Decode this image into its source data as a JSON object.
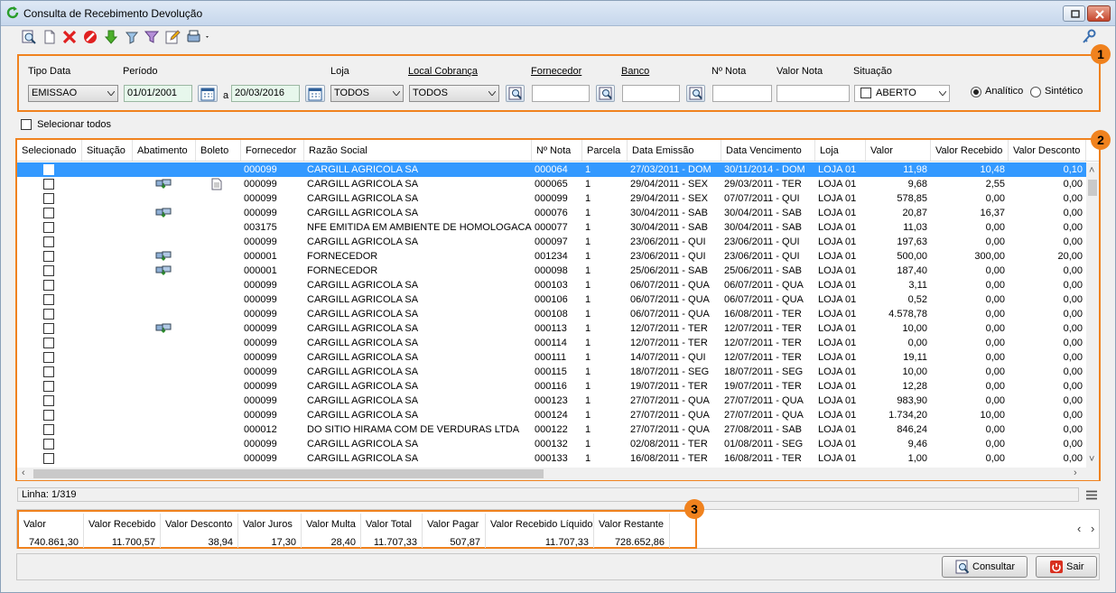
{
  "window": {
    "title": "Consulta de Recebimento Devolução"
  },
  "toolbar": {
    "icons": [
      "search-doc-icon",
      "new-doc-icon",
      "delete-icon",
      "cancel-icon",
      "download-arrow-icon",
      "filter-settings-icon",
      "funnel-icon",
      "edit-icon",
      "print-icon"
    ]
  },
  "filters": {
    "tipo_data_label": "Tipo Data",
    "tipo_data_value": "EMISSAO",
    "periodo_label": "Período",
    "periodo_start": "01/01/2001",
    "periodo_sep": "a",
    "periodo_end": "20/03/2016",
    "loja_label": "Loja",
    "loja_value": "TODOS",
    "local_cobranca_label": "Local Cobrança",
    "local_cobranca_value": "TODOS",
    "fornecedor_label": "Fornecedor",
    "fornecedor_value": "",
    "banco_label": "Banco",
    "banco_value": "",
    "nota_label": "Nº Nota",
    "nota_value": "",
    "valor_nota_label": "Valor Nota",
    "valor_nota_value": "",
    "situacao_label": "Situação",
    "situacao_value": "ABERTO",
    "analitico_label": "Analítico",
    "sintetico_label": "Sintético"
  },
  "badges": [
    "1",
    "2",
    "3"
  ],
  "select_all_label": "Selecionar todos",
  "grid": {
    "columns": [
      "Selecionado",
      "Situação",
      "Abatimento",
      "Boleto",
      "Fornecedor",
      "Razão Social",
      "Nº Nota",
      "Parcela",
      "Data Emissão",
      "Data Vencimento",
      "Loja",
      "Valor",
      "Valor Recebido",
      "Valor Desconto"
    ],
    "rows": [
      {
        "abat": false,
        "boleto": false,
        "fornecedor": "000099",
        "razao": "CARGILL AGRICOLA SA",
        "nota": "000064",
        "parcela": "1",
        "emissao": "27/03/2011 - DOM",
        "venc": "30/11/2014 - DOM",
        "loja": "LOJA 01",
        "valor": "11,98",
        "recebido": "10,48",
        "desconto": "0,10"
      },
      {
        "abat": true,
        "boleto": true,
        "fornecedor": "000099",
        "razao": "CARGILL AGRICOLA SA",
        "nota": "000065",
        "parcela": "1",
        "emissao": "29/04/2011 - SEX",
        "venc": "29/03/2011 - TER",
        "loja": "LOJA 01",
        "valor": "9,68",
        "recebido": "2,55",
        "desconto": "0,00"
      },
      {
        "abat": false,
        "boleto": false,
        "fornecedor": "000099",
        "razao": "CARGILL AGRICOLA SA",
        "nota": "000099",
        "parcela": "1",
        "emissao": "29/04/2011 - SEX",
        "venc": "07/07/2011 - QUI",
        "loja": "LOJA 01",
        "valor": "578,85",
        "recebido": "0,00",
        "desconto": "0,00"
      },
      {
        "abat": true,
        "boleto": false,
        "fornecedor": "000099",
        "razao": "CARGILL AGRICOLA SA",
        "nota": "000076",
        "parcela": "1",
        "emissao": "30/04/2011 - SAB",
        "venc": "30/04/2011 - SAB",
        "loja": "LOJA 01",
        "valor": "20,87",
        "recebido": "16,37",
        "desconto": "0,00"
      },
      {
        "abat": false,
        "boleto": false,
        "fornecedor": "003175",
        "razao": "NFE EMITIDA EM AMBIENTE DE HOMOLOGACAO",
        "nota": "000077",
        "parcela": "1",
        "emissao": "30/04/2011 - SAB",
        "venc": "30/04/2011 - SAB",
        "loja": "LOJA 01",
        "valor": "11,03",
        "recebido": "0,00",
        "desconto": "0,00"
      },
      {
        "abat": false,
        "boleto": false,
        "fornecedor": "000099",
        "razao": "CARGILL AGRICOLA SA",
        "nota": "000097",
        "parcela": "1",
        "emissao": "23/06/2011 - QUI",
        "venc": "23/06/2011 - QUI",
        "loja": "LOJA 01",
        "valor": "197,63",
        "recebido": "0,00",
        "desconto": "0,00"
      },
      {
        "abat": true,
        "boleto": false,
        "fornecedor": "000001",
        "razao": "FORNECEDOR",
        "nota": "001234",
        "parcela": "1",
        "emissao": "23/06/2011 - QUI",
        "venc": "23/06/2011 - QUI",
        "loja": "LOJA 01",
        "valor": "500,00",
        "recebido": "300,00",
        "desconto": "20,00"
      },
      {
        "abat": true,
        "boleto": false,
        "fornecedor": "000001",
        "razao": "FORNECEDOR",
        "nota": "000098",
        "parcela": "1",
        "emissao": "25/06/2011 - SAB",
        "venc": "25/06/2011 - SAB",
        "loja": "LOJA 01",
        "valor": "187,40",
        "recebido": "0,00",
        "desconto": "0,00"
      },
      {
        "abat": false,
        "boleto": false,
        "fornecedor": "000099",
        "razao": "CARGILL AGRICOLA SA",
        "nota": "000103",
        "parcela": "1",
        "emissao": "06/07/2011 - QUA",
        "venc": "06/07/2011 - QUA",
        "loja": "LOJA 01",
        "valor": "3,11",
        "recebido": "0,00",
        "desconto": "0,00"
      },
      {
        "abat": false,
        "boleto": false,
        "fornecedor": "000099",
        "razao": "CARGILL AGRICOLA SA",
        "nota": "000106",
        "parcela": "1",
        "emissao": "06/07/2011 - QUA",
        "venc": "06/07/2011 - QUA",
        "loja": "LOJA 01",
        "valor": "0,52",
        "recebido": "0,00",
        "desconto": "0,00"
      },
      {
        "abat": false,
        "boleto": false,
        "fornecedor": "000099",
        "razao": "CARGILL AGRICOLA SA",
        "nota": "000108",
        "parcela": "1",
        "emissao": "06/07/2011 - QUA",
        "venc": "16/08/2011 - TER",
        "loja": "LOJA 01",
        "valor": "4.578,78",
        "recebido": "0,00",
        "desconto": "0,00"
      },
      {
        "abat": true,
        "boleto": false,
        "fornecedor": "000099",
        "razao": "CARGILL AGRICOLA SA",
        "nota": "000113",
        "parcela": "1",
        "emissao": "12/07/2011 - TER",
        "venc": "12/07/2011 - TER",
        "loja": "LOJA 01",
        "valor": "10,00",
        "recebido": "0,00",
        "desconto": "0,00"
      },
      {
        "abat": false,
        "boleto": false,
        "fornecedor": "000099",
        "razao": "CARGILL AGRICOLA SA",
        "nota": "000114",
        "parcela": "1",
        "emissao": "12/07/2011 - TER",
        "venc": "12/07/2011 - TER",
        "loja": "LOJA 01",
        "valor": "0,00",
        "recebido": "0,00",
        "desconto": "0,00"
      },
      {
        "abat": false,
        "boleto": false,
        "fornecedor": "000099",
        "razao": "CARGILL AGRICOLA SA",
        "nota": "000111",
        "parcela": "1",
        "emissao": "14/07/2011 - QUI",
        "venc": "12/07/2011 - TER",
        "loja": "LOJA 01",
        "valor": "19,11",
        "recebido": "0,00",
        "desconto": "0,00"
      },
      {
        "abat": false,
        "boleto": false,
        "fornecedor": "000099",
        "razao": "CARGILL AGRICOLA SA",
        "nota": "000115",
        "parcela": "1",
        "emissao": "18/07/2011 - SEG",
        "venc": "18/07/2011 - SEG",
        "loja": "LOJA 01",
        "valor": "10,00",
        "recebido": "0,00",
        "desconto": "0,00"
      },
      {
        "abat": false,
        "boleto": false,
        "fornecedor": "000099",
        "razao": "CARGILL AGRICOLA SA",
        "nota": "000116",
        "parcela": "1",
        "emissao": "19/07/2011 - TER",
        "venc": "19/07/2011 - TER",
        "loja": "LOJA 01",
        "valor": "12,28",
        "recebido": "0,00",
        "desconto": "0,00"
      },
      {
        "abat": false,
        "boleto": false,
        "fornecedor": "000099",
        "razao": "CARGILL AGRICOLA SA",
        "nota": "000123",
        "parcela": "1",
        "emissao": "27/07/2011 - QUA",
        "venc": "27/07/2011 - QUA",
        "loja": "LOJA 01",
        "valor": "983,90",
        "recebido": "0,00",
        "desconto": "0,00"
      },
      {
        "abat": false,
        "boleto": false,
        "fornecedor": "000099",
        "razao": "CARGILL AGRICOLA SA",
        "nota": "000124",
        "parcela": "1",
        "emissao": "27/07/2011 - QUA",
        "venc": "27/07/2011 - QUA",
        "loja": "LOJA 01",
        "valor": "1.734,20",
        "recebido": "10,00",
        "desconto": "0,00"
      },
      {
        "abat": false,
        "boleto": false,
        "fornecedor": "000012",
        "razao": "DO SITIO HIRAMA COM DE VERDURAS LTDA",
        "nota": "000122",
        "parcela": "1",
        "emissao": "27/07/2011 - QUA",
        "venc": "27/08/2011 - SAB",
        "loja": "LOJA 01",
        "valor": "846,24",
        "recebido": "0,00",
        "desconto": "0,00"
      },
      {
        "abat": false,
        "boleto": false,
        "fornecedor": "000099",
        "razao": "CARGILL AGRICOLA SA",
        "nota": "000132",
        "parcela": "1",
        "emissao": "02/08/2011 - TER",
        "venc": "01/08/2011 - SEG",
        "loja": "LOJA 01",
        "valor": "9,46",
        "recebido": "0,00",
        "desconto": "0,00"
      },
      {
        "abat": false,
        "boleto": false,
        "fornecedor": "000099",
        "razao": "CARGILL AGRICOLA SA",
        "nota": "000133",
        "parcela": "1",
        "emissao": "16/08/2011 - TER",
        "venc": "16/08/2011 - TER",
        "loja": "LOJA 01",
        "valor": "1,00",
        "recebido": "0,00",
        "desconto": "0,00"
      }
    ]
  },
  "status": {
    "linha": "Linha: 1/319"
  },
  "totals": [
    {
      "label": "Valor",
      "value": "740.861,30"
    },
    {
      "label": "Valor Recebido",
      "value": "11.700,57"
    },
    {
      "label": "Valor Desconto",
      "value": "38,94"
    },
    {
      "label": "Valor Juros",
      "value": "17,30"
    },
    {
      "label": "Valor Multa",
      "value": "28,40"
    },
    {
      "label": "Valor Total",
      "value": "11.707,33"
    },
    {
      "label": "Valor Pagar",
      "value": "507,87"
    },
    {
      "label": "Valor Recebido Líquido",
      "value": "11.707,33"
    },
    {
      "label": "Valor Restante",
      "value": "728.652,86"
    }
  ],
  "buttons": {
    "consultar": "Consultar",
    "sair": "Sair"
  },
  "colors": {
    "accent_orange": "#f0821e",
    "selection_blue": "#3399ff"
  }
}
